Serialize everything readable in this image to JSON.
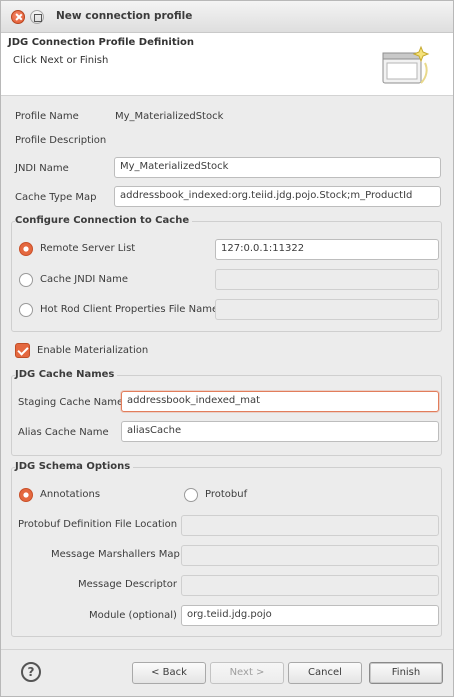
{
  "window": {
    "title": "New connection profile"
  },
  "banner": {
    "title": "JDG Connection Profile Definition",
    "subtitle": "Click Next or Finish"
  },
  "profile": {
    "name_label": "Profile Name",
    "name_value": "My_MaterializedStock",
    "description_label": "Profile Description",
    "jndi_label": "JNDI Name",
    "jndi_value": "My_MaterializedStock",
    "cache_type_label": "Cache Type Map",
    "cache_type_value": "addressbook_indexed:org.teiid.jdg.pojo.Stock;m_ProductId"
  },
  "connection": {
    "title": "Configure Connection to Cache",
    "remote_label": "Remote Server List",
    "remote_value": "127:0.0.1:11322",
    "jndi_label": "Cache JNDI Name",
    "hotrod_label": "Hot Rod Client Properties File Name"
  },
  "materialization": {
    "label": "Enable Materialization",
    "checked": true
  },
  "cache_names": {
    "title": "JDG Cache Names",
    "staging_label": "Staging Cache Name",
    "staging_value": "addressbook_indexed_mat",
    "alias_label": "Alias Cache Name",
    "alias_value": "aliasCache"
  },
  "schema": {
    "title": "JDG Schema Options",
    "annotations_label": "Annotations",
    "protobuf_label": "Protobuf",
    "protobuf_file_label": "Protobuf Definition File Location",
    "marshallers_label": "Message Marshallers Map",
    "descriptor_label": "Message Descriptor",
    "module_label": "Module (optional)",
    "module_value": "org.teiid.jdg.pojo"
  },
  "footer": {
    "help": "?",
    "back": "< Back",
    "next": "Next >",
    "cancel": "Cancel",
    "finish": "Finish"
  },
  "colors": {
    "accent": "#e4683f",
    "background": "#ececec"
  }
}
